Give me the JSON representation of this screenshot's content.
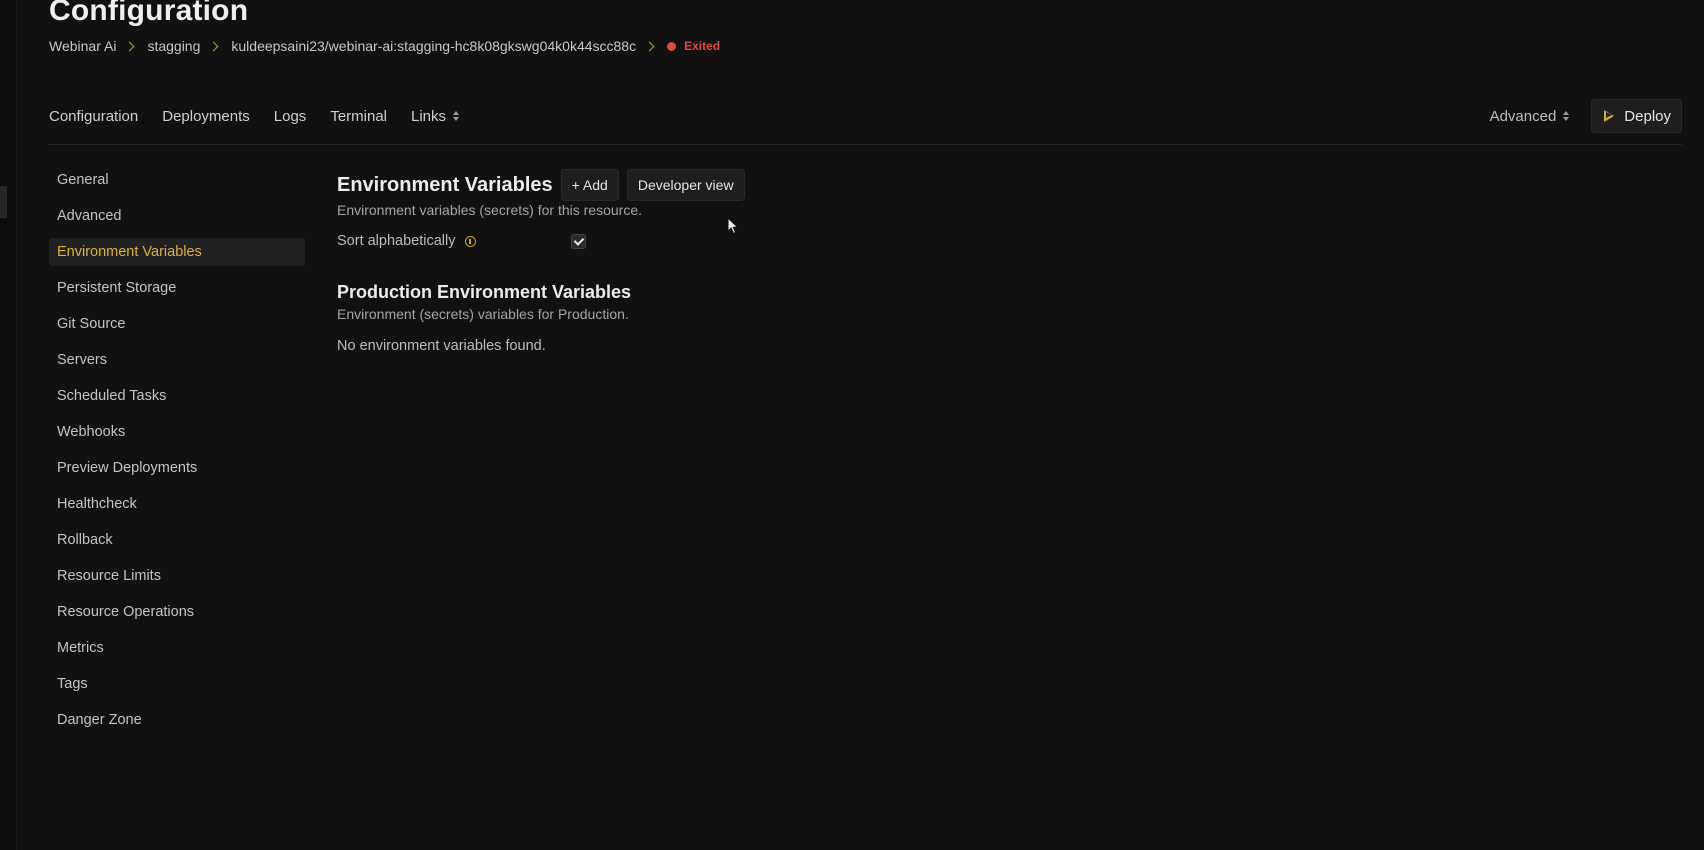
{
  "page": {
    "title": "Configuration"
  },
  "breadcrumb": {
    "items": [
      "Webinar Ai",
      "stagging",
      "kuldeepsaini23/webinar-ai:stagging-hc8k08gkswg04k0k44scc88c"
    ],
    "status": "Exited",
    "status_color": "#e5483d"
  },
  "nav": {
    "items": [
      "Configuration",
      "Deployments",
      "Logs",
      "Terminal",
      "Links"
    ],
    "advanced_label": "Advanced",
    "deploy_label": "Deploy"
  },
  "sidebar": {
    "items": [
      {
        "label": "General"
      },
      {
        "label": "Advanced"
      },
      {
        "label": "Environment Variables",
        "active": true
      },
      {
        "label": "Persistent Storage"
      },
      {
        "label": "Git Source"
      },
      {
        "label": "Servers"
      },
      {
        "label": "Scheduled Tasks"
      },
      {
        "label": "Webhooks"
      },
      {
        "label": "Preview Deployments"
      },
      {
        "label": "Healthcheck"
      },
      {
        "label": "Rollback"
      },
      {
        "label": "Resource Limits"
      },
      {
        "label": "Resource Operations"
      },
      {
        "label": "Metrics"
      },
      {
        "label": "Tags"
      },
      {
        "label": "Danger Zone"
      }
    ],
    "active_color": "#e0b03f"
  },
  "main": {
    "title": "Environment Variables",
    "add_label": "+ Add",
    "developer_view_label": "Developer view",
    "subtitle": "Environment variables (secrets) for this resource.",
    "sort_label": "Sort alphabetically",
    "sort_checked": true,
    "production": {
      "title": "Production Environment Variables",
      "subtitle": "Environment (secrets) variables for Production.",
      "empty_text": "No environment variables found."
    }
  },
  "icons": {
    "breadcrumb_separator": "chevron-right-icon",
    "status": "status-dot-icon",
    "sort": "updown-icon",
    "deploy": "play-icon",
    "info": "info-icon",
    "pointer": "mouse-cursor-icon"
  }
}
